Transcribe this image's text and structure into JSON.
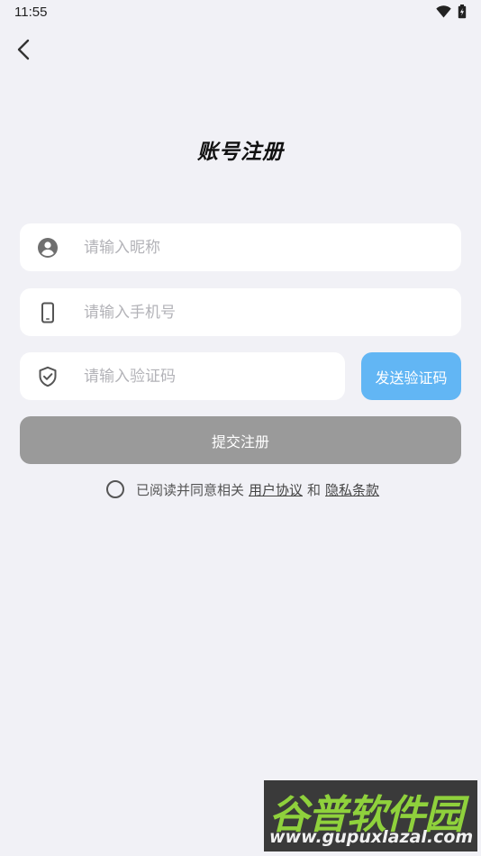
{
  "status_bar": {
    "time": "11:55",
    "wifi_icon": "wifi-icon",
    "battery_icon": "battery-charging-icon"
  },
  "header": {
    "back_icon": "chevron-left-icon",
    "title": "账号注册"
  },
  "form": {
    "nickname": {
      "placeholder": "请输入昵称",
      "value": "",
      "icon": "user-circle-icon"
    },
    "phone": {
      "placeholder": "请输入手机号",
      "value": "",
      "icon": "smartphone-icon"
    },
    "code": {
      "placeholder": "请输入验证码",
      "value": "",
      "icon": "shield-check-icon"
    },
    "send_code_label": "发送验证码",
    "submit_label": "提交注册"
  },
  "agreement": {
    "prefix": "已阅读并同意相关",
    "user_agreement": "用户协议",
    "conjunction": "和",
    "privacy_policy": "隐私条款",
    "checked": false
  },
  "colors": {
    "background": "#f1f1f6",
    "send_code_button": "#62b6f4",
    "submit_button_disabled": "#9a9a9a",
    "field_background": "#ffffff"
  },
  "watermark": {
    "logo_text": "谷普软件园",
    "url": "www.gupuxlazal.com"
  }
}
